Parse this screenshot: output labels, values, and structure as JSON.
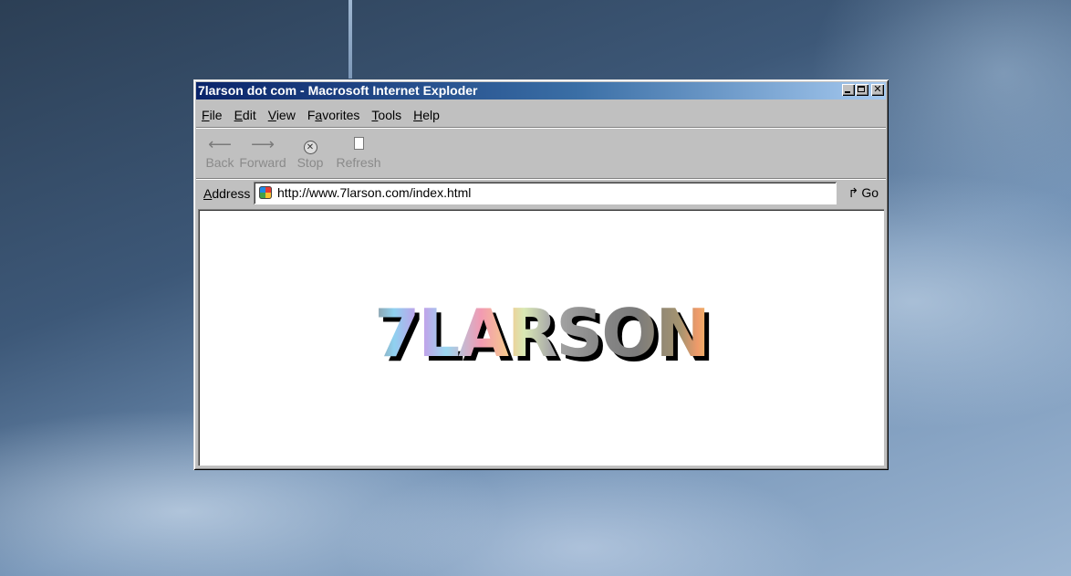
{
  "window": {
    "title": "7larson dot com - Macrosoft Internet Exploder"
  },
  "menu": {
    "items": [
      {
        "mnemonic": "F",
        "rest": "ile"
      },
      {
        "mnemonic": "E",
        "rest": "dit"
      },
      {
        "mnemonic": "V",
        "rest": "iew"
      },
      {
        "pre": "F",
        "mnemonic": "a",
        "rest": "vorites"
      },
      {
        "mnemonic": "T",
        "rest": "ools"
      },
      {
        "mnemonic": "H",
        "rest": "elp"
      }
    ]
  },
  "toolbar": {
    "back_label": "Back",
    "forward_label": "Forward",
    "stop_label": "Stop",
    "refresh_label": "Refresh"
  },
  "address": {
    "label_mnemonic": "A",
    "label_rest": "ddress",
    "url": "http://www.7larson.com/index.html",
    "go_label": "Go"
  },
  "content": {
    "logo_text": "7LARSON"
  },
  "colors": {
    "title_gradient_start": "#0a246a",
    "title_gradient_end": "#a6caf0",
    "chrome": "#c0c0c0"
  }
}
